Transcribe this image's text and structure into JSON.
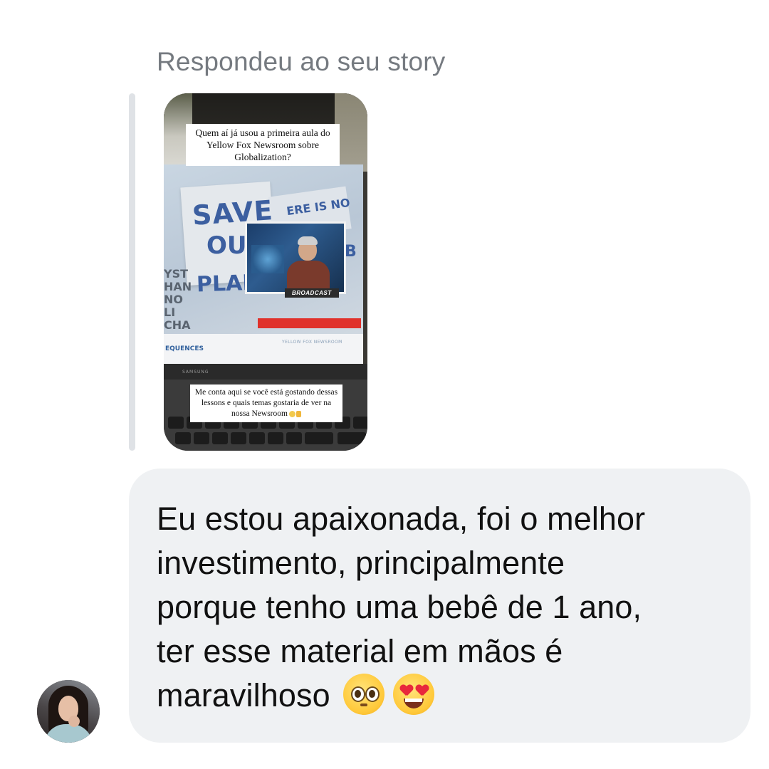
{
  "reply": {
    "caption": "Respondeu ao seu story"
  },
  "story": {
    "caption_top": "Quem aí já usou a primeira aula do Yellow Fox Newsroom sobre Globalization?",
    "caption_bottom": "Me conta aqui se você está gostando dessas lessons e quais temas gostaria de ver na nossa Newsroom",
    "photo": {
      "sign_save": "SAVE",
      "sign_u": "OU",
      "sign_plan": "PLAN",
      "sign_ereisno": "ERE IS NO",
      "sign_b": "B",
      "sign_left": "YST\nHAN\nNO\nLI\nCHA",
      "broadcast": "BROADCAST",
      "sequences": "EQUENCES",
      "brand": "YELLOW FOX NEWSROOM",
      "laptop_brand": "SAMSUNG"
    }
  },
  "message": {
    "lines": [
      "Eu estou apaixonada, foi o melhor",
      "investimento, principalmente",
      "porque tenho uma bebê de 1 ano,",
      "ter esse material em mãos é",
      "maravilhoso"
    ],
    "emojis": [
      "pleading-face-emoji",
      "heart-eyes-emoji"
    ]
  },
  "colors": {
    "caption": "#757a80",
    "bubble": "#eff1f3",
    "quote_bar": "#dfe2e6",
    "text": "#111111"
  }
}
